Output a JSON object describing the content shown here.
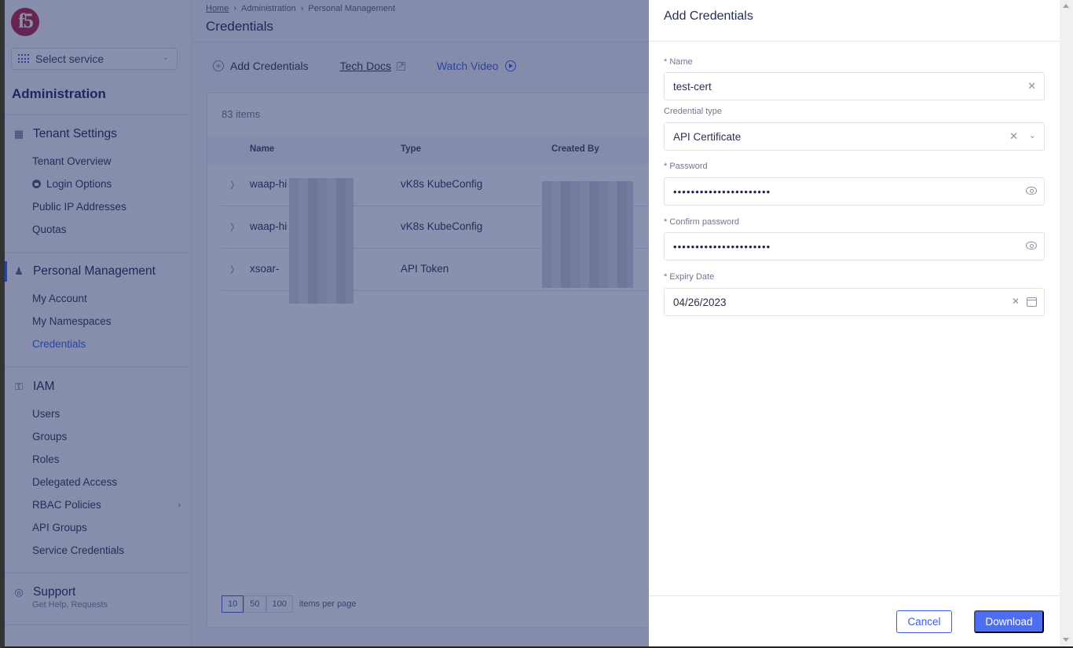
{
  "sidebar": {
    "logo": "f5",
    "service_select": {
      "label": "Select service",
      "icon": "apps-grid-icon"
    },
    "title": "Administration",
    "sections": [
      {
        "label": "Tenant Settings",
        "icon": "building-settings-icon",
        "items": [
          {
            "label": "Tenant Overview"
          },
          {
            "label": "Login Options",
            "icon": "lock-icon"
          },
          {
            "label": "Public IP Addresses"
          },
          {
            "label": "Quotas"
          }
        ]
      },
      {
        "label": "Personal Management",
        "icon": "user-settings-icon",
        "active": true,
        "items": [
          {
            "label": "My Account"
          },
          {
            "label": "My Namespaces"
          },
          {
            "label": "Credentials",
            "active": true
          }
        ]
      },
      {
        "label": "IAM",
        "icon": "key-icon",
        "items": [
          {
            "label": "Users"
          },
          {
            "label": "Groups"
          },
          {
            "label": "Roles"
          },
          {
            "label": "Delegated Access"
          },
          {
            "label": "RBAC Policies",
            "has_submenu": true
          },
          {
            "label": "API Groups"
          },
          {
            "label": "Service Credentials"
          }
        ]
      },
      {
        "label": "Support",
        "icon": "lifebuoy-icon",
        "subtitle": "Get Help, Requests"
      }
    ]
  },
  "main": {
    "breadcrumb": [
      "Home",
      "Administration",
      "Personal Management"
    ],
    "title": "Credentials",
    "actions": {
      "add": "Add Credentials",
      "docs": "Tech Docs",
      "video": "Watch Video"
    },
    "count": "83 items",
    "table": {
      "columns": [
        "Name",
        "Type",
        "Created By"
      ],
      "rows": [
        {
          "name": "waap-hi",
          "type": "vK8s KubeConfig",
          "created_by": ""
        },
        {
          "name": "waap-hi",
          "type": "vK8s KubeConfig",
          "created_by": ""
        },
        {
          "name": "xsoar-",
          "type": "API Token",
          "created_by": ""
        }
      ]
    },
    "pagination": {
      "sizes": [
        "10",
        "50",
        "100"
      ],
      "selected": "10",
      "label": "items per page"
    }
  },
  "drawer": {
    "title": "Add Credentials",
    "fields": {
      "name": {
        "label": "* Name",
        "value": "test-cert"
      },
      "type": {
        "label": "Credential type",
        "value": "API Certificate"
      },
      "password": {
        "label": "* Password",
        "value": "••••••••••••••••••••••"
      },
      "confirm": {
        "label": "* Confirm password",
        "value": "••••••••••••••••••••••"
      },
      "expiry": {
        "label": "* Expiry Date",
        "value": "04/26/2023"
      }
    },
    "cancel": "Cancel",
    "download": "Download"
  },
  "colors": {
    "accent": "#3b5bdb",
    "primary_button": "#4e6ef2",
    "brand": "#b41f3d",
    "overlay": "#1e2c64"
  }
}
